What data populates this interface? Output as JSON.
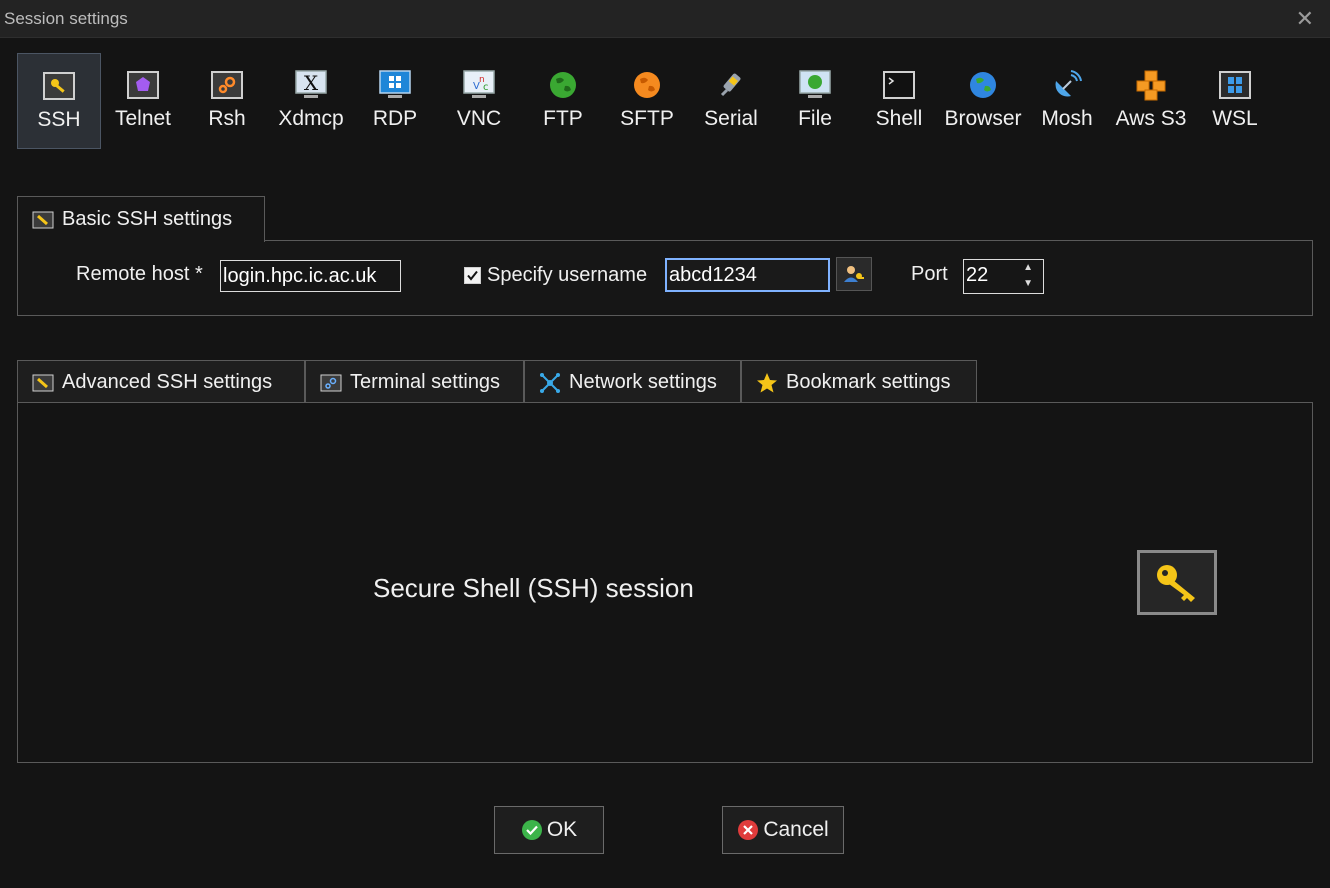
{
  "window": {
    "title": "Session settings",
    "close_glyph": "✕"
  },
  "session_types": [
    {
      "label": "SSH",
      "icon": "key-icon",
      "active": true
    },
    {
      "label": "Telnet",
      "icon": "purple-gem-icon"
    },
    {
      "label": "Rsh",
      "icon": "gears-icon"
    },
    {
      "label": "Xdmcp",
      "icon": "x-monitor-icon"
    },
    {
      "label": "RDP",
      "icon": "windows-monitor-icon"
    },
    {
      "label": "VNC",
      "icon": "vnc-monitor-icon"
    },
    {
      "label": "FTP",
      "icon": "green-globe-icon"
    },
    {
      "label": "SFTP",
      "icon": "orange-globe-icon"
    },
    {
      "label": "Serial",
      "icon": "serial-plug-icon"
    },
    {
      "label": "File",
      "icon": "file-monitor-icon"
    },
    {
      "label": "Shell",
      "icon": "terminal-icon"
    },
    {
      "label": "Browser",
      "icon": "browser-globe-icon"
    },
    {
      "label": "Mosh",
      "icon": "satellite-dish-icon"
    },
    {
      "label": "Aws S3",
      "icon": "cubes-icon"
    },
    {
      "label": "WSL",
      "icon": "windows-logo-icon"
    }
  ],
  "basic_tab": {
    "label": "Basic SSH settings"
  },
  "basic": {
    "remote_host_label": "Remote host *",
    "remote_host_value": "login.hpc.ic.ac.uk",
    "specify_username_label": "Specify username",
    "specify_username_checked": true,
    "username_value": "abcd1234",
    "port_label": "Port",
    "port_value": "22"
  },
  "advanced_tabs": [
    {
      "label": "Advanced SSH settings",
      "icon": "wrench-icon"
    },
    {
      "label": "Terminal settings",
      "icon": "terminal-settings-icon"
    },
    {
      "label": "Network settings",
      "icon": "network-icon"
    },
    {
      "label": "Bookmark settings",
      "icon": "star-icon"
    }
  ],
  "session_description": "Secure Shell (SSH) session",
  "buttons": {
    "ok": "OK",
    "cancel": "Cancel"
  },
  "colors": {
    "background": "#141414",
    "accent_key": "#f5c518",
    "focus_border": "#7fb2ff",
    "ok_green": "#3cb44a",
    "cancel_red": "#e03c3c"
  }
}
